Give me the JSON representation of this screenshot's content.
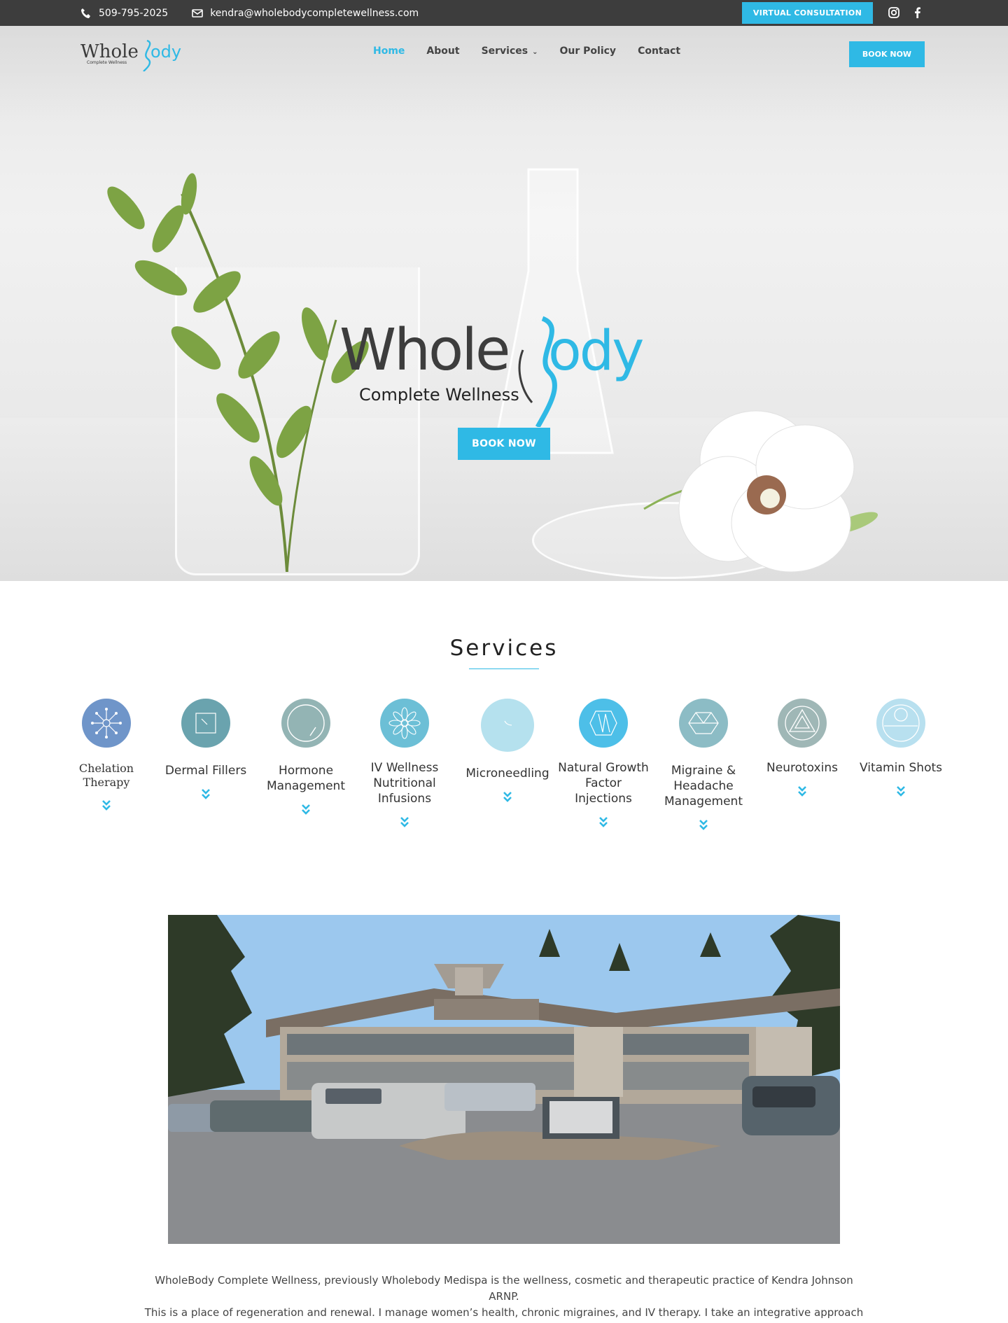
{
  "topbar": {
    "phone": "509-795-2025",
    "email": "kendra@wholebodycompletewellness.com",
    "cta_label": "VIRTUAL CONSULTATION",
    "social_icons": [
      "instagram-icon",
      "facebook-icon"
    ]
  },
  "nav": {
    "logo": {
      "word_left": "Whole",
      "word_right": "ody",
      "tagline": "Complete Wellness"
    },
    "items": [
      {
        "label": "Home",
        "active": true
      },
      {
        "label": "About",
        "active": false
      },
      {
        "label": "Services",
        "active": false,
        "has_dropdown": true
      },
      {
        "label": "Our Policy",
        "active": false
      },
      {
        "label": "Contact",
        "active": false
      }
    ],
    "book_label": "BOOK NOW"
  },
  "hero": {
    "logo": {
      "word_left": "Whole",
      "word_right": "ody",
      "tagline": "Complete Wellness"
    },
    "book_label": "BOOK NOW"
  },
  "services": {
    "title": "Services",
    "items": [
      {
        "label": "Chelation Therapy",
        "icon": "chelation-icon",
        "color": "#6f95c9"
      },
      {
        "label": "Dermal Fillers",
        "icon": "dermal-fillers-icon",
        "color": "#6aa3ae"
      },
      {
        "label": "Hormone Management",
        "icon": "hormone-icon",
        "color": "#93b4b4"
      },
      {
        "label": "IV Wellness Nutritional Infusions",
        "icon": "iv-infusion-icon",
        "color": "#6cbfd6"
      },
      {
        "label": "Microneedling",
        "icon": "microneedling-icon",
        "color": "#b5e1ee"
      },
      {
        "label": "Natural Growth Factor Injections",
        "icon": "growth-factor-icon",
        "color": "#4dbfe8"
      },
      {
        "label": "Migraine & Headache Management",
        "icon": "migraine-icon",
        "color": "#8cbcc5"
      },
      {
        "label": "Neurotoxins",
        "icon": "neurotoxin-icon",
        "color": "#9fb7b6"
      },
      {
        "label": "Vitamin Shots",
        "icon": "vitamin-icon",
        "color": "#b8e0ef"
      }
    ]
  },
  "about": {
    "paragraph_1": "WholeBody Complete Wellness, previously Wholebody Medispa is the wellness, cosmetic and therapeutic practice of Kendra Johnson ARNP.",
    "paragraph_2": "This is a place of regeneration and renewal. I manage women’s health, chronic migraines, and IV therapy. I take an integrative approach to"
  },
  "colors": {
    "accent": "#2fb9e5",
    "topbar": "#3d3d3d",
    "text": "#333333"
  }
}
